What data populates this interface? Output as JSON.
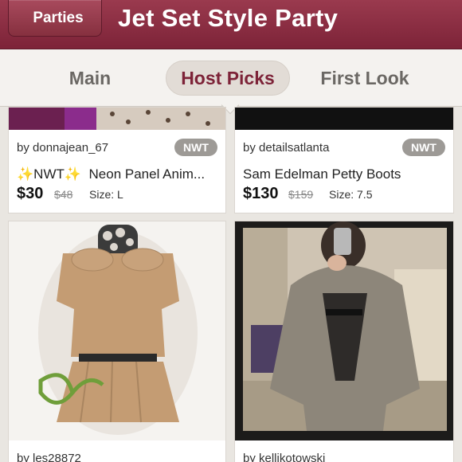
{
  "header": {
    "back_label": "Parties",
    "title": "Jet Set Style Party"
  },
  "tabs": [
    {
      "label": "Main",
      "active": false
    },
    {
      "label": "Host Picks",
      "active": true
    },
    {
      "label": "First Look",
      "active": false
    }
  ],
  "listings": [
    {
      "seller": "by donnajean_67",
      "badge": "NWT",
      "title_sparkle": "✨",
      "title_nwt": "NWT",
      "title_sparkle2": "✨",
      "title_text": "Neon Panel Anim...",
      "price": "$30",
      "original_price": "$48",
      "size": "Size: L"
    },
    {
      "seller": "by detailsatlanta",
      "badge": "NWT",
      "title": "Sam Edelman Petty Boots",
      "price": "$130",
      "original_price": "$159",
      "size": "Size: 7.5"
    },
    {
      "seller": "by les28872"
    },
    {
      "seller": "by kellikotowski"
    }
  ],
  "colors": {
    "brand": "#7d2338",
    "badge": "#9d9a96"
  }
}
